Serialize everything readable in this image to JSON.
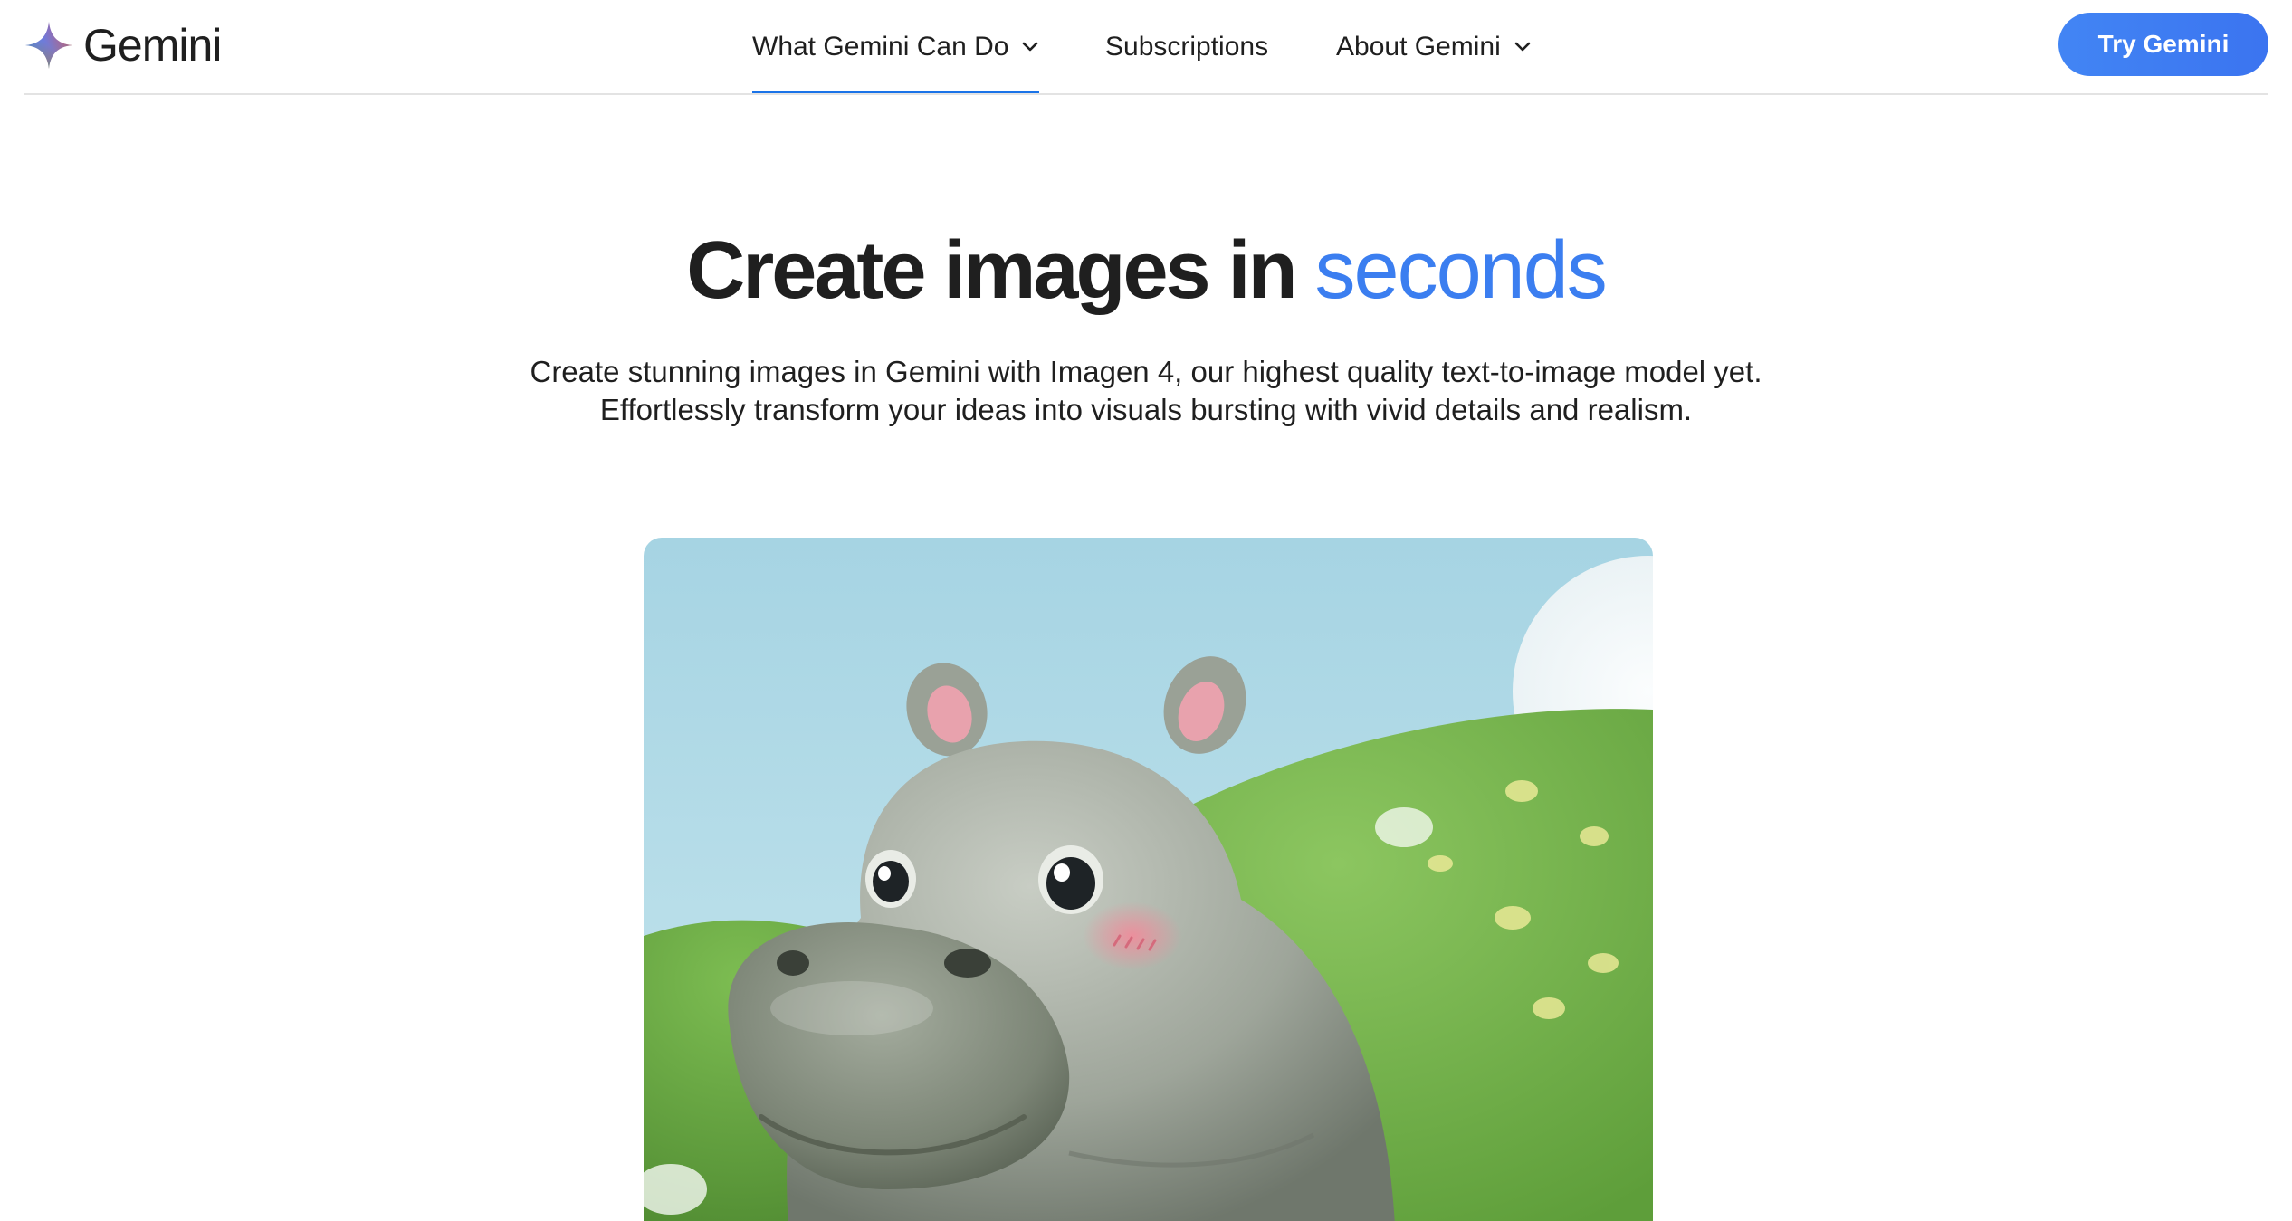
{
  "header": {
    "brand": {
      "name": "Gemini",
      "logo_icon": "gemini-sparkle-icon"
    },
    "nav": [
      {
        "label": "What Gemini Can Do",
        "has_dropdown": true,
        "active": true
      },
      {
        "label": "Subscriptions",
        "has_dropdown": false,
        "active": false
      },
      {
        "label": "About Gemini",
        "has_dropdown": true,
        "active": false
      }
    ],
    "cta_label": "Try Gemini"
  },
  "hero": {
    "title_main": "Create images in ",
    "title_accent": "seconds",
    "subtitle_line1": "Create stunning images in Gemini with Imagen 4, our highest quality text-to-image model yet.",
    "subtitle_line2": "Effortlessly transform your ideas into visuals bursting with vivid details and realism."
  },
  "colors": {
    "accent": "#3b7ef0",
    "cta": "#4285f4",
    "active_underline": "#1a73e8",
    "text": "#1f1f1f",
    "divider": "#e3e3e3"
  }
}
